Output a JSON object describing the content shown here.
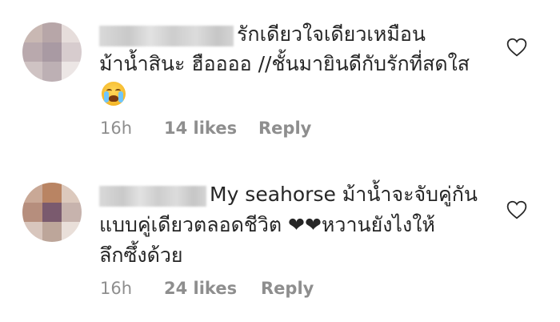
{
  "comments": [
    {
      "text_line1": "รักเดียวใจเดียวเหมือน",
      "text_line2": "ม้าน้ำสินะ ฮืออออ //ชั้นมายินดีกับรักที่สดใส",
      "emoji": "loudly-crying-face-icon",
      "time": "16h",
      "likes": "14 likes",
      "reply": "Reply",
      "avatar_colors": [
        "#c9b8b3",
        "#b7a6a8",
        "#e6dddb",
        "#b9a9ad",
        "#a99aa3",
        "#d7ccce",
        "#cfc3c3",
        "#bdb0b4",
        "#ece6e5"
      ]
    },
    {
      "text_line1": "My seahorse ม้าน้ำจะจับคู่กัน",
      "text_line2": "แบบคู่เดียวตลอดชีวิต ❤❤หวานยังไงให้",
      "text_line3": "ลึกซึ้งด้วย",
      "time": "16h",
      "likes": "24 likes",
      "reply": "Reply",
      "avatar_colors": [
        "#c9a896",
        "#b98463",
        "#dcc9bd",
        "#b68e7d",
        "#7a5a6e",
        "#c7b3ad",
        "#d8c6bd",
        "#bda69a",
        "#e9dfd9"
      ]
    }
  ],
  "icons": {
    "like": "heart-outline-icon"
  },
  "colors": {
    "text": "#262626",
    "meta": "#8e8e8e",
    "heart_stroke": "#262626"
  }
}
